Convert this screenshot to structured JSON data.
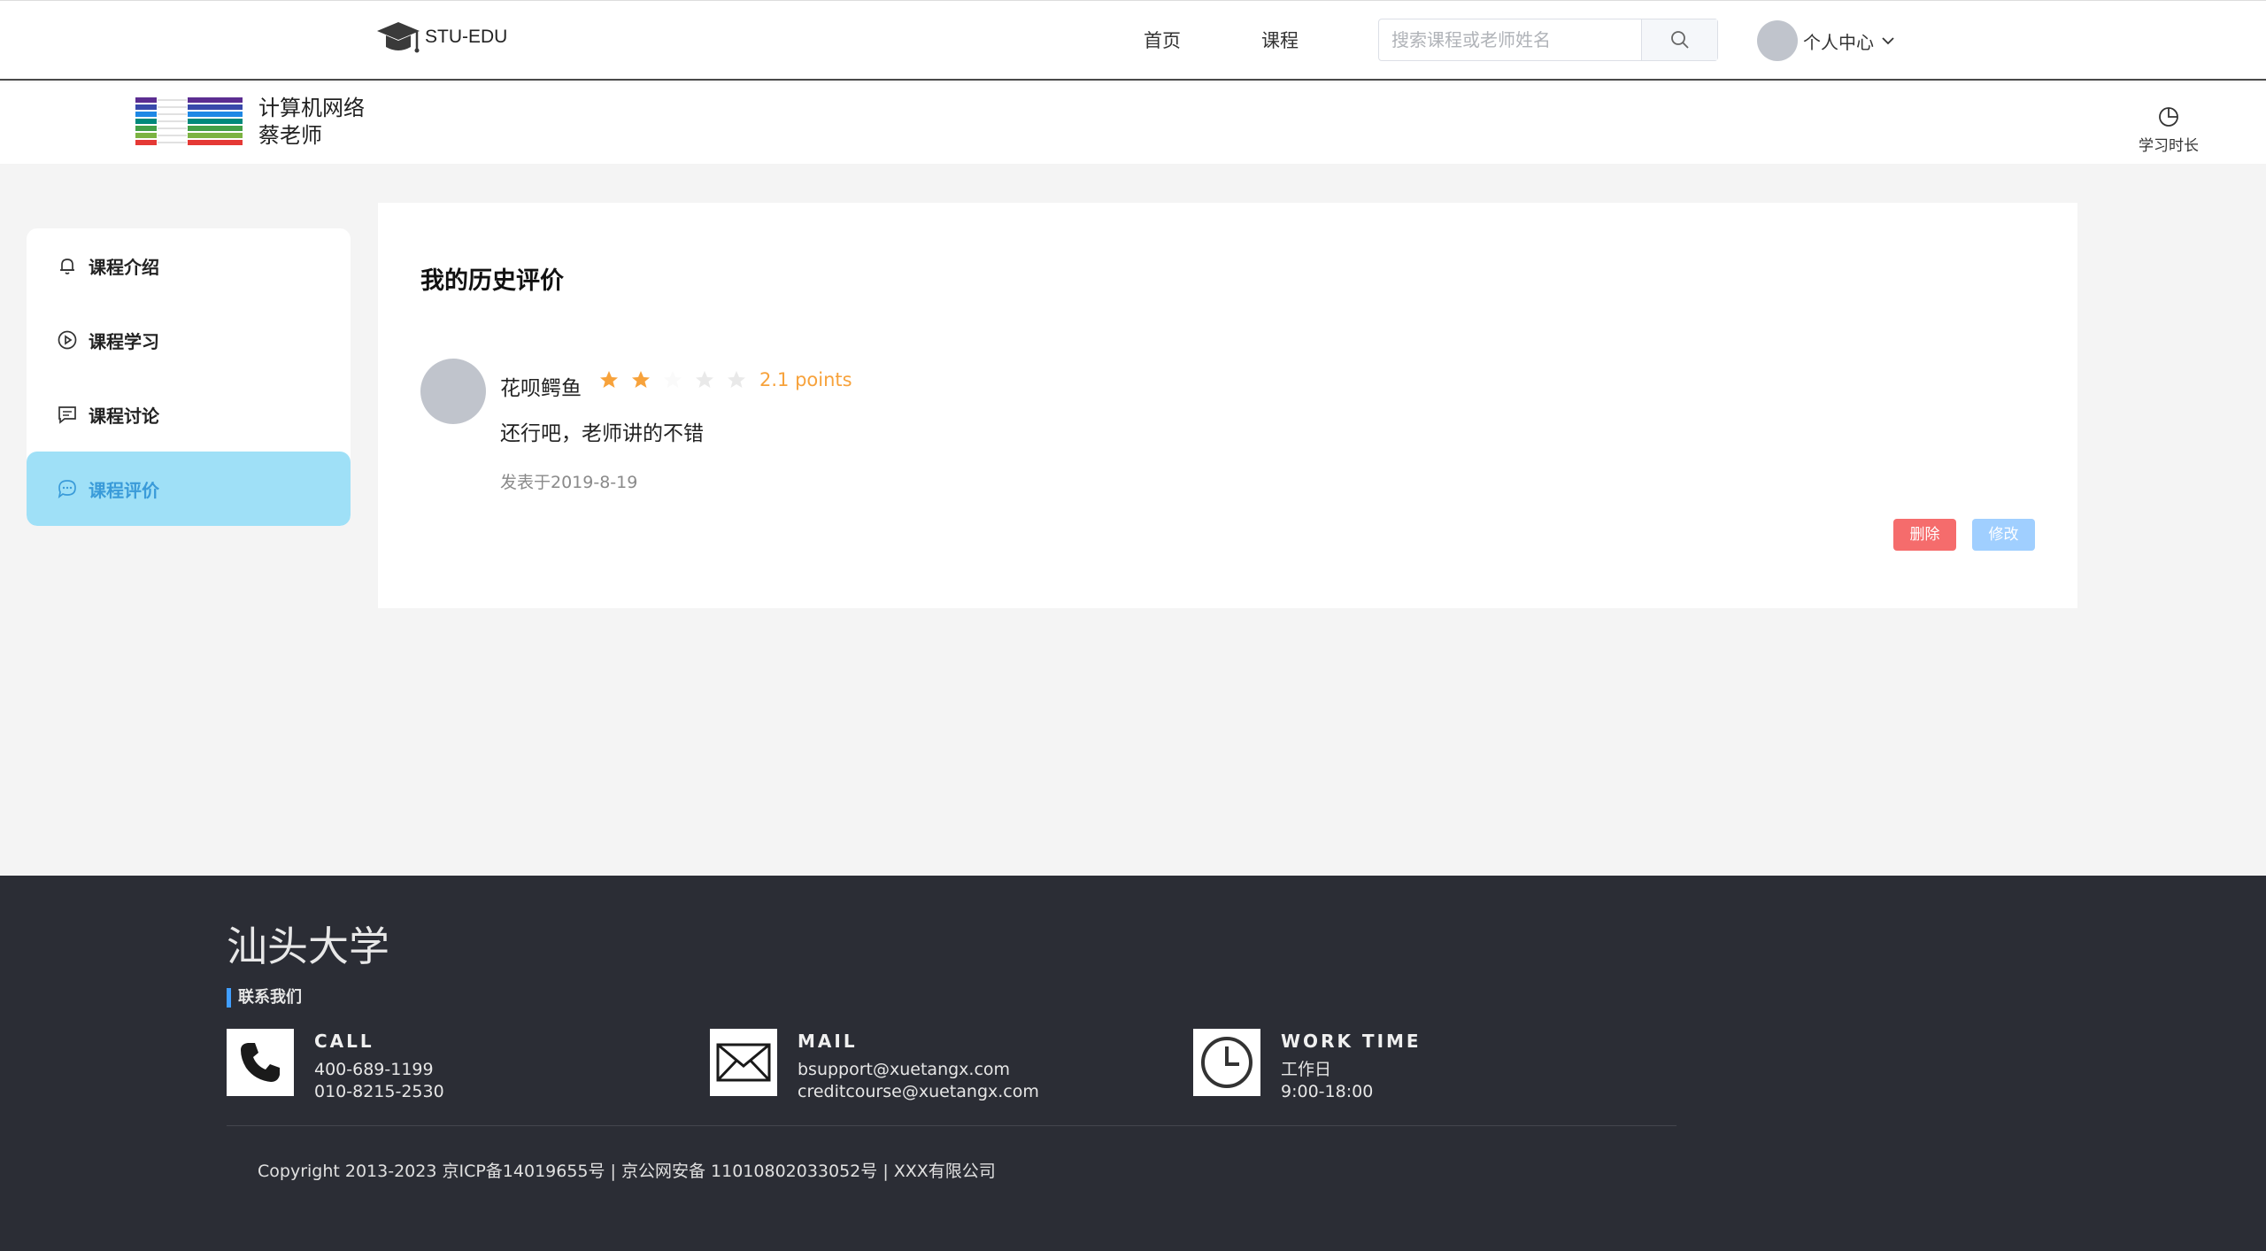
{
  "header": {
    "logo_text": "STU-EDU",
    "nav": [
      {
        "label": "首页"
      },
      {
        "label": "课程"
      }
    ],
    "search": {
      "placeholder": "搜索课程或老师姓名"
    },
    "user": {
      "label": "个人中心"
    }
  },
  "course": {
    "name": "计算机网络",
    "teacher": "蔡老师",
    "study_time_label": "学习时长"
  },
  "sidebar": {
    "items": [
      {
        "label": "课程介绍",
        "icon": "bell-icon"
      },
      {
        "label": "课程学习",
        "icon": "play-circle-icon"
      },
      {
        "label": "课程讨论",
        "icon": "comment-icon"
      },
      {
        "label": "课程评价",
        "icon": "chat-bubble-icon",
        "active": true
      }
    ]
  },
  "review_panel": {
    "title": "我的历史评价",
    "review": {
      "username": "花呗鳄鱼",
      "rating": 2.1,
      "rating_max": 5,
      "rating_text": "2.1 points",
      "text": "还行吧，老师讲的不错",
      "date": "发表于2019-8-19"
    },
    "delete_label": "删除",
    "edit_label": "修改"
  },
  "footer": {
    "university": "汕头大学",
    "contact_title": "联系我们",
    "call": {
      "heading": "CALL",
      "lines": [
        "400-689-1199",
        "010-8215-2530"
      ]
    },
    "mail": {
      "heading": "MAIL",
      "lines": [
        "bsupport@xuetangx.com",
        "creditcourse@xuetangx.com"
      ]
    },
    "work": {
      "heading": "WORK TIME",
      "lines": [
        "工作日",
        "9:00-18:00"
      ]
    },
    "copyright": "Copyright 2013-2023 京ICP备14019655号 | 京公网安备 11010802033052号 | XXX有限公司"
  },
  "colors": {
    "accent": "#409eff",
    "active_bg": "#9fe0f7",
    "star": "#f7a23b",
    "delete": "#f56c6c",
    "edit": "#a0cfff",
    "footer_bg": "#2b2d35"
  }
}
